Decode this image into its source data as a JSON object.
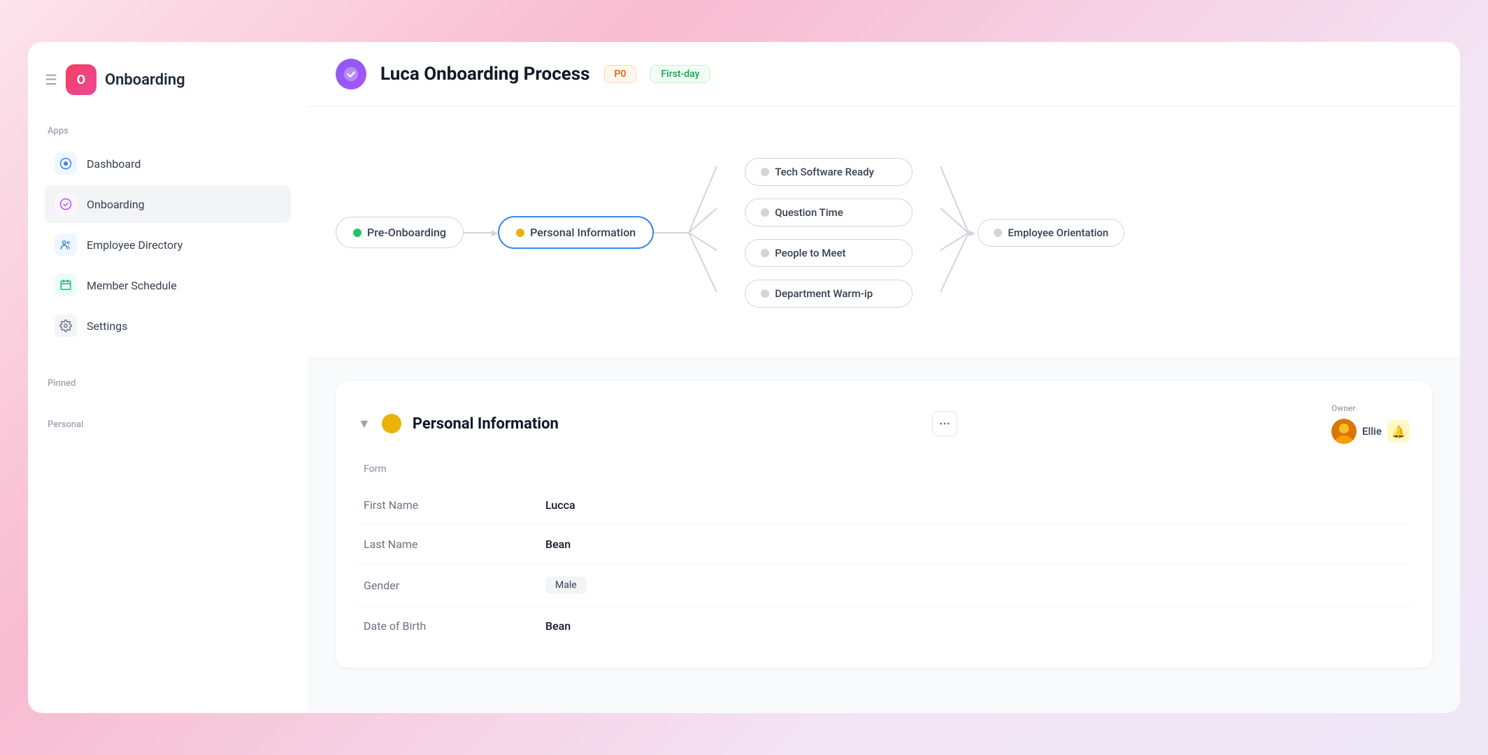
{
  "app": {
    "title": "Onboarding",
    "logo_letter": "O"
  },
  "sidebar": {
    "section_apps": "Apps",
    "section_pinned": "Pinned",
    "section_personal": "Personal",
    "nav_items": [
      {
        "id": "dashboard",
        "label": "Dashboard",
        "icon": "🔵"
      },
      {
        "id": "onboarding",
        "label": "Onboarding",
        "icon": "🟣"
      },
      {
        "id": "employee-directory",
        "label": "Employee Directory",
        "icon": "🔵"
      },
      {
        "id": "member-schedule",
        "label": "Member Schedule",
        "icon": "🟢"
      },
      {
        "id": "settings",
        "label": "Settings",
        "icon": "⚙️"
      }
    ]
  },
  "header": {
    "title": "Luca Onboarding Process",
    "badge_p0": "P0",
    "badge_firstday": "First-day"
  },
  "flow": {
    "node_pre_onboarding": "Pre-Onboarding",
    "node_personal_info": "Personal Information",
    "node_tech_software": "Tech Software Ready",
    "node_question_time": "Question Time",
    "node_people_to_meet": "People to Meet",
    "node_department_warmup": "Department Warm-ip",
    "node_employee_orientation": "Employee Orientation"
  },
  "detail": {
    "title": "Personal Information",
    "owner_label": "Owner",
    "owner_name": "Ellie",
    "form_section": "Form",
    "fields": [
      {
        "label": "First Name",
        "value": "Lucca",
        "type": "text"
      },
      {
        "label": "Last Name",
        "value": "Bean",
        "type": "text"
      },
      {
        "label": "Gender",
        "value": "Male",
        "type": "badge"
      },
      {
        "label": "Date of Birth",
        "value": "Bean",
        "type": "text"
      }
    ]
  }
}
